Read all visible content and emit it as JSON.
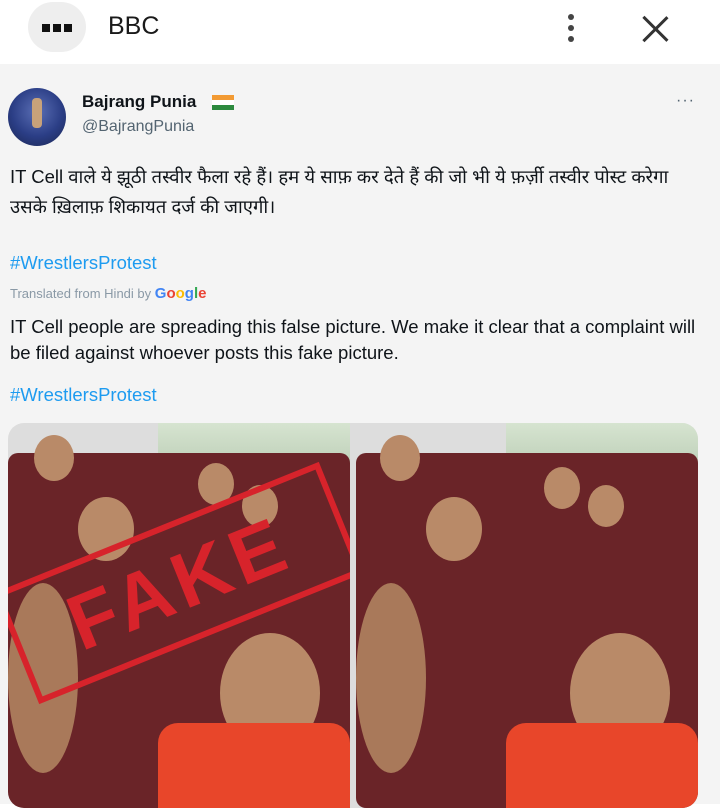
{
  "header": {
    "title": "BBC",
    "menu_icon": "grid-dots-icon",
    "more_icon": "vertical-dots-icon",
    "close_icon": "close-icon"
  },
  "tweet": {
    "author_name": "Bajrang Punia",
    "author_handle": "@BajrangPunia",
    "more_label": "···",
    "text_hindi": "IT Cell वाले ये झूठी तस्वीर फैला रहे हैं। हम ये साफ़ कर देते हैं की जो भी ये फ़र्ज़ी तस्वीर पोस्ट करेगा उसके ख़िलाफ़ शिकायत दर्ज की जाएगी।",
    "hashtag_hindi": "#WrestlersProtest",
    "translated_label": "Translated from Hindi by",
    "translated_by": "Google",
    "text_english": "IT Cell people are spreading this false picture. We make it clear that a complaint will be filed against whoever posts this fake picture.",
    "hashtag_english": "#WrestlersProtest",
    "fake_stamp": "FAKE"
  },
  "colors": {
    "link": "#1d9bf0",
    "stamp": "#d7232b",
    "shirt": "#e8462a",
    "seat": "#7a2a2e"
  }
}
